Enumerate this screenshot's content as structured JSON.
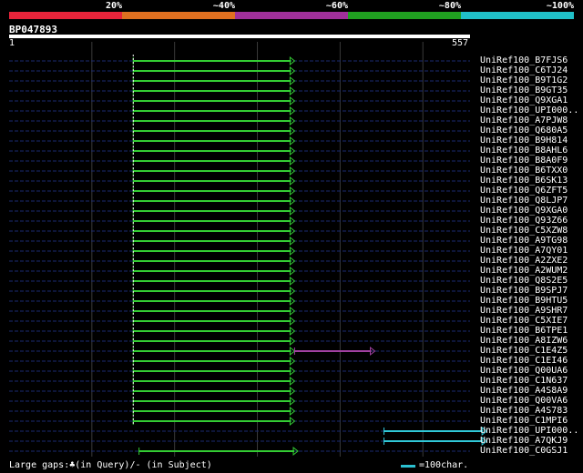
{
  "legend": {
    "segments": [
      {
        "label": "20%",
        "color": "#e8243a"
      },
      {
        "label": "~40%",
        "color": "#e07020"
      },
      {
        "label": "~60%",
        "color": "#a0309a"
      },
      {
        "label": "~80%",
        "color": "#20a020"
      },
      {
        "label": "~100%",
        "color": "#20c0c8"
      }
    ]
  },
  "query": {
    "id": "BP047893",
    "start": "1",
    "end": "557",
    "length": 557
  },
  "colors": {
    "background": "#000000",
    "green": "#33cc33",
    "purple": "#a040a0",
    "cyan": "#30c8d8",
    "dashed_line": "#1a2a70",
    "grid": "#3a3a3a"
  },
  "hits": [
    {
      "name": "UniRef100_B7FJS6",
      "segments": [
        {
          "start": 150,
          "end": 345,
          "color": "green"
        }
      ]
    },
    {
      "name": "UniRef100_C6TJ24",
      "segments": [
        {
          "start": 150,
          "end": 345,
          "color": "green"
        }
      ]
    },
    {
      "name": "UniRef100_B9T1G2",
      "segments": [
        {
          "start": 150,
          "end": 345,
          "color": "green"
        }
      ]
    },
    {
      "name": "UniRef100_B9GT35",
      "segments": [
        {
          "start": 150,
          "end": 345,
          "color": "green"
        }
      ]
    },
    {
      "name": "UniRef100_Q9XGA1",
      "segments": [
        {
          "start": 150,
          "end": 345,
          "color": "green"
        }
      ]
    },
    {
      "name": "UniRef100_UPI000..",
      "segments": [
        {
          "start": 150,
          "end": 345,
          "color": "green"
        }
      ]
    },
    {
      "name": "UniRef100_A7PJW8",
      "segments": [
        {
          "start": 150,
          "end": 345,
          "color": "green"
        }
      ]
    },
    {
      "name": "UniRef100_Q680A5",
      "segments": [
        {
          "start": 150,
          "end": 345,
          "color": "green"
        }
      ]
    },
    {
      "name": "UniRef100_B9H814",
      "segments": [
        {
          "start": 150,
          "end": 345,
          "color": "green"
        }
      ]
    },
    {
      "name": "UniRef100_B8AHL6",
      "segments": [
        {
          "start": 150,
          "end": 345,
          "color": "green"
        }
      ]
    },
    {
      "name": "UniRef100_B8A0F9",
      "segments": [
        {
          "start": 150,
          "end": 345,
          "color": "green"
        }
      ]
    },
    {
      "name": "UniRef100_B6TXX0",
      "segments": [
        {
          "start": 150,
          "end": 345,
          "color": "green"
        }
      ]
    },
    {
      "name": "UniRef100_B6SK13",
      "segments": [
        {
          "start": 150,
          "end": 345,
          "color": "green"
        }
      ]
    },
    {
      "name": "UniRef100_Q6ZFT5",
      "segments": [
        {
          "start": 150,
          "end": 345,
          "color": "green"
        }
      ]
    },
    {
      "name": "UniRef100_Q8LJP7",
      "segments": [
        {
          "start": 150,
          "end": 345,
          "color": "green"
        }
      ]
    },
    {
      "name": "UniRef100_Q9XGA0",
      "segments": [
        {
          "start": 150,
          "end": 345,
          "color": "green"
        }
      ]
    },
    {
      "name": "UniRef100_Q93Z66",
      "segments": [
        {
          "start": 150,
          "end": 345,
          "color": "green"
        }
      ]
    },
    {
      "name": "UniRef100_C5XZW8",
      "segments": [
        {
          "start": 150,
          "end": 345,
          "color": "green"
        }
      ]
    },
    {
      "name": "UniRef100_A9TG98",
      "segments": [
        {
          "start": 150,
          "end": 345,
          "color": "green"
        }
      ]
    },
    {
      "name": "UniRef100_A7QY01",
      "segments": [
        {
          "start": 150,
          "end": 345,
          "color": "green"
        }
      ]
    },
    {
      "name": "UniRef100_A2ZXE2",
      "segments": [
        {
          "start": 150,
          "end": 345,
          "color": "green"
        }
      ]
    },
    {
      "name": "UniRef100_A2WUM2",
      "segments": [
        {
          "start": 150,
          "end": 345,
          "color": "green"
        }
      ]
    },
    {
      "name": "UniRef100_Q8S2E5",
      "segments": [
        {
          "start": 150,
          "end": 345,
          "color": "green"
        }
      ]
    },
    {
      "name": "UniRef100_B9SPJ7",
      "segments": [
        {
          "start": 150,
          "end": 345,
          "color": "green"
        }
      ]
    },
    {
      "name": "UniRef100_B9HTU5",
      "segments": [
        {
          "start": 150,
          "end": 345,
          "color": "green"
        }
      ]
    },
    {
      "name": "UniRef100_A9SHR7",
      "segments": [
        {
          "start": 150,
          "end": 345,
          "color": "green"
        }
      ]
    },
    {
      "name": "UniRef100_C5XIE7",
      "segments": [
        {
          "start": 150,
          "end": 345,
          "color": "green"
        }
      ]
    },
    {
      "name": "UniRef100_B6TPE1",
      "segments": [
        {
          "start": 150,
          "end": 345,
          "color": "green"
        }
      ]
    },
    {
      "name": "UniRef100_A8IZW6",
      "segments": [
        {
          "start": 150,
          "end": 345,
          "color": "green"
        }
      ]
    },
    {
      "name": "UniRef100_C1E4Z5",
      "segments": [
        {
          "start": 150,
          "end": 345,
          "color": "green"
        },
        {
          "start": 345,
          "end": 442,
          "color": "purple"
        }
      ]
    },
    {
      "name": "UniRef100_C1EI46",
      "segments": [
        {
          "start": 150,
          "end": 345,
          "color": "green"
        }
      ]
    },
    {
      "name": "UniRef100_Q00UA6",
      "segments": [
        {
          "start": 150,
          "end": 345,
          "color": "green"
        }
      ]
    },
    {
      "name": "UniRef100_C1N637",
      "segments": [
        {
          "start": 150,
          "end": 345,
          "color": "green"
        }
      ]
    },
    {
      "name": "UniRef100_A4S8A9",
      "segments": [
        {
          "start": 150,
          "end": 345,
          "color": "green"
        }
      ]
    },
    {
      "name": "UniRef100_Q00VA6",
      "segments": [
        {
          "start": 150,
          "end": 345,
          "color": "green"
        }
      ]
    },
    {
      "name": "UniRef100_A4S783",
      "segments": [
        {
          "start": 150,
          "end": 345,
          "color": "green"
        }
      ]
    },
    {
      "name": "UniRef100_C1MPI6",
      "segments": [
        {
          "start": 150,
          "end": 345,
          "color": "green"
        }
      ]
    },
    {
      "name": "UniRef100_UPI000..",
      "segments": [
        {
          "start": 453,
          "end": 577,
          "color": "cyan"
        }
      ]
    },
    {
      "name": "UniRef100_A7QKJ9",
      "segments": [
        {
          "start": 453,
          "end": 577,
          "color": "cyan"
        }
      ]
    },
    {
      "name": "UniRef100_C0GSJ1",
      "segments": [
        {
          "start": 157,
          "end": 349,
          "color": "green"
        }
      ]
    }
  ],
  "footer": {
    "large_gaps": "Large gaps:♣(in Query)/- (in Subject)",
    "scale": "=100char."
  }
}
